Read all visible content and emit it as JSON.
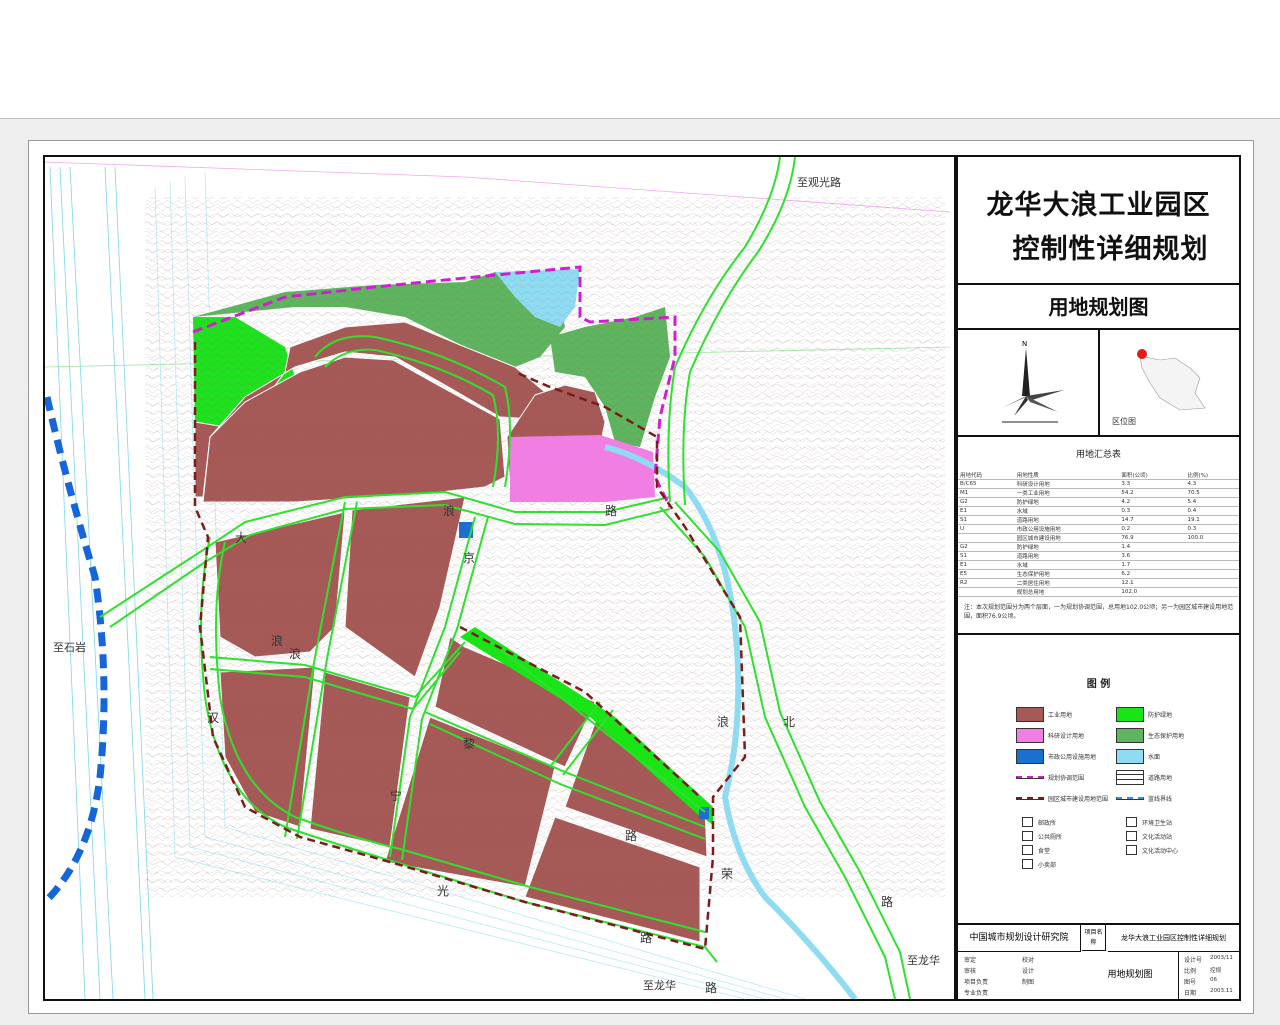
{
  "title": {
    "line1": "龙华大浪工业园区",
    "line2": "控制性详细规划"
  },
  "map_name": "用地规划图",
  "north_label": "N",
  "location_label": "区位图",
  "summary_title": "用地汇总表",
  "summary_headers": [
    "用地代码",
    "用地性质",
    "面积(公顷)",
    "比例(%)"
  ],
  "summary_rows": [
    [
      "B/C65",
      "科研设计用地",
      "3.3",
      "4.3"
    ],
    [
      "M1",
      "一类工业用地",
      "54.2",
      "70.5"
    ],
    [
      "G2",
      "防护绿地",
      "4.2",
      "5.4"
    ],
    [
      "E1",
      "水域",
      "0.3",
      "0.4"
    ],
    [
      "S1",
      "道路用地",
      "14.7",
      "19.1"
    ],
    [
      "U",
      "市政公用设施用地",
      "0.2",
      "0.3"
    ],
    [
      "",
      "园区城市建设用地",
      "76.9",
      "100.0"
    ],
    [
      "G2",
      "防护绿地",
      "1.4",
      ""
    ],
    [
      "S1",
      "道路用地",
      "3.6",
      ""
    ],
    [
      "E1",
      "水域",
      "1.7",
      ""
    ],
    [
      "E5",
      "生态保护用地",
      "6.2",
      ""
    ],
    [
      "R2",
      "二类居住用地",
      "12.1",
      ""
    ],
    [
      "",
      "规划总用地",
      "102.0",
      ""
    ]
  ],
  "note": "注：本次规划范围分为两个层面，一为规划协调范围，总用地102.0公顷；另一为园区城市建设用地范围，面积76.9公顷。",
  "legend_title": "图 例",
  "legend_items": [
    {
      "label": "工业用地",
      "color": "#a65a58"
    },
    {
      "label": "防护绿地",
      "color": "#18e418"
    },
    {
      "label": "科研设计用地",
      "color": "#f07ee3"
    },
    {
      "label": "生态保护用地",
      "color": "#5fb55f"
    },
    {
      "label": "市政公用设施用地",
      "color": "#1b6fd1"
    },
    {
      "label": "水面",
      "color": "#8fdcf2"
    },
    {
      "label": "规划协调范围",
      "color": "#d21ed2"
    },
    {
      "label": "道路用地",
      "color": "#ffffff"
    },
    {
      "label": "园区城市建设用地范围",
      "color": "#7a1c1c"
    },
    {
      "label": "蓝线界线",
      "color": "#3a8fd8"
    }
  ],
  "legend_icons": [
    "邮政所",
    "环境卫生站",
    "公共厕所",
    "文化活动站",
    "食堂",
    "文化活动中心",
    "小卖部"
  ],
  "map_labels": {
    "north_road": "至观光路",
    "west_road": "至石岩",
    "south_road": "至龙华",
    "east_road": "至龙华",
    "road_chars_a": [
      "大",
      "浪",
      "路"
    ],
    "road_chars_b": [
      "浪",
      "宁",
      "路"
    ],
    "road_chars_c": [
      "黎",
      "光",
      "路"
    ],
    "road_chars_d": [
      "浪",
      "北",
      "路"
    ],
    "road_chars_e": [
      "荣",
      "路"
    ],
    "misc": [
      "汉",
      "浪",
      "京"
    ]
  },
  "title_block": {
    "institute": "中国城市规划设计研究院",
    "project_label": "项目名称",
    "project_name": "龙华大浪工业园区控制性详细规划",
    "drawing_name": "用地规划图",
    "roles": [
      "审定",
      "审核",
      "项目负责",
      "专业负责",
      "校对",
      "设计",
      "制图"
    ],
    "meta_labels": [
      "设计号",
      "比例",
      "图号",
      "日期"
    ],
    "meta_values": [
      "2003/11",
      "控规",
      "06",
      "2003.11"
    ]
  }
}
